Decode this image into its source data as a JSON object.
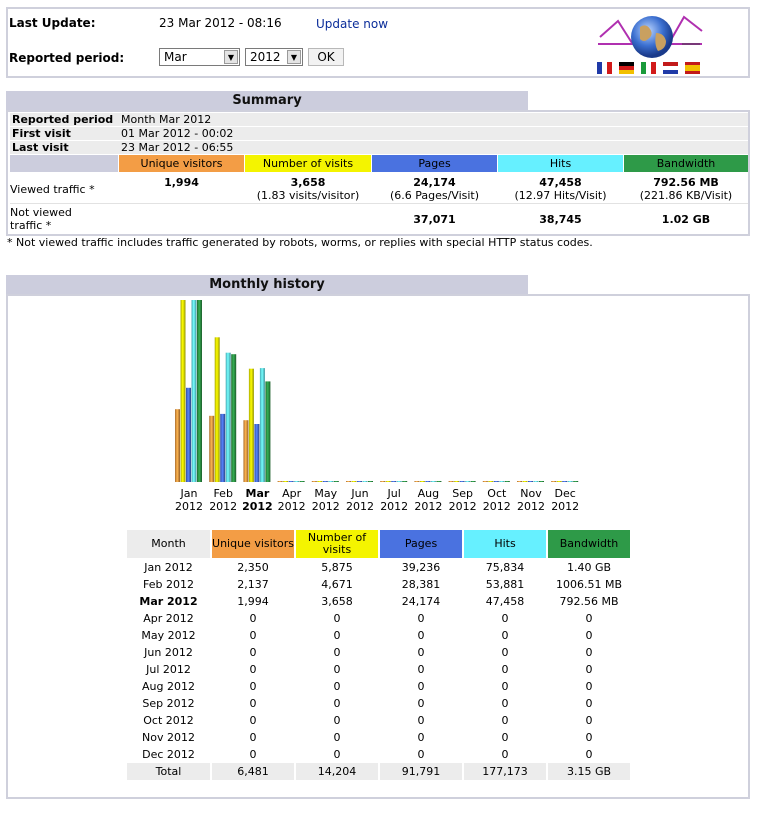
{
  "top": {
    "last_update_label": "Last Update:",
    "last_update_value": "23 Mar 2012 - 08:16",
    "update_now": "Update now",
    "reported_period_label": "Reported period:",
    "month_select": "Mar",
    "year_select": "2012",
    "ok": "OK"
  },
  "summary": {
    "title": "Summary",
    "reported_period_label": "Reported period",
    "reported_period_value": "Month Mar 2012",
    "first_visit_label": "First visit",
    "first_visit_value": "01 Mar 2012 - 00:02",
    "last_visit_label": "Last visit",
    "last_visit_value": "23 Mar 2012 - 06:55",
    "columns": [
      "Unique visitors",
      "Number of visits",
      "Pages",
      "Hits",
      "Bandwidth"
    ],
    "viewed_label": "Viewed traffic *",
    "viewed": {
      "unique": "1,994",
      "visits": "3,658",
      "visits_sub": "(1.83 visits/visitor)",
      "pages": "24,174",
      "pages_sub": "(6.6 Pages/Visit)",
      "hits": "47,458",
      "hits_sub": "(12.97 Hits/Visit)",
      "bandwidth": "792.56 MB",
      "bandwidth_sub": "(221.86 KB/Visit)"
    },
    "not_viewed_label_1": "Not viewed",
    "not_viewed_label_2": "traffic *",
    "not_viewed": {
      "pages": "37,071",
      "hits": "38,745",
      "bandwidth": "1.02 GB"
    },
    "footnote": "* Not viewed traffic includes traffic generated by robots, worms, or replies with special HTTP status codes."
  },
  "monthly": {
    "title": "Monthly history",
    "headers": [
      "Month",
      "Unique visitors",
      "Number of visits",
      "Pages",
      "Hits",
      "Bandwidth"
    ],
    "rows": [
      {
        "month": "Jan 2012",
        "unique": "2,350",
        "visits": "5,875",
        "pages": "39,236",
        "hits": "75,834",
        "bandwidth": "1.40 GB"
      },
      {
        "month": "Feb 2012",
        "unique": "2,137",
        "visits": "4,671",
        "pages": "28,381",
        "hits": "53,881",
        "bandwidth": "1006.51 MB"
      },
      {
        "month": "Mar 2012",
        "unique": "1,994",
        "visits": "3,658",
        "pages": "24,174",
        "hits": "47,458",
        "bandwidth": "792.56 MB"
      },
      {
        "month": "Apr 2012",
        "unique": "0",
        "visits": "0",
        "pages": "0",
        "hits": "0",
        "bandwidth": "0"
      },
      {
        "month": "May 2012",
        "unique": "0",
        "visits": "0",
        "pages": "0",
        "hits": "0",
        "bandwidth": "0"
      },
      {
        "month": "Jun 2012",
        "unique": "0",
        "visits": "0",
        "pages": "0",
        "hits": "0",
        "bandwidth": "0"
      },
      {
        "month": "Jul 2012",
        "unique": "0",
        "visits": "0",
        "pages": "0",
        "hits": "0",
        "bandwidth": "0"
      },
      {
        "month": "Aug 2012",
        "unique": "0",
        "visits": "0",
        "pages": "0",
        "hits": "0",
        "bandwidth": "0"
      },
      {
        "month": "Sep 2012",
        "unique": "0",
        "visits": "0",
        "pages": "0",
        "hits": "0",
        "bandwidth": "0"
      },
      {
        "month": "Oct 2012",
        "unique": "0",
        "visits": "0",
        "pages": "0",
        "hits": "0",
        "bandwidth": "0"
      },
      {
        "month": "Nov 2012",
        "unique": "0",
        "visits": "0",
        "pages": "0",
        "hits": "0",
        "bandwidth": "0"
      },
      {
        "month": "Dec 2012",
        "unique": "0",
        "visits": "0",
        "pages": "0",
        "hits": "0",
        "bandwidth": "0"
      }
    ],
    "total": {
      "month": "Total",
      "unique": "6,481",
      "visits": "14,204",
      "pages": "91,791",
      "hits": "177,173",
      "bandwidth": "3.15 GB"
    }
  },
  "colors": {
    "unique": "#f39d45",
    "visits": "#f4f400",
    "pages": "#4a72e0",
    "hits": "#66f0ff",
    "bandwidth": "#2e9a48",
    "header_tab": "#cccddd",
    "link": "#0b2d9a"
  },
  "chart_data": {
    "type": "bar",
    "categories": [
      {
        "month": "Jan",
        "year": "2012"
      },
      {
        "month": "Feb",
        "year": "2012"
      },
      {
        "month": "Mar",
        "year": "2012"
      },
      {
        "month": "Apr",
        "year": "2012"
      },
      {
        "month": "May",
        "year": "2012"
      },
      {
        "month": "Jun",
        "year": "2012"
      },
      {
        "month": "Jul",
        "year": "2012"
      },
      {
        "month": "Aug",
        "year": "2012"
      },
      {
        "month": "Sep",
        "year": "2012"
      },
      {
        "month": "Oct",
        "year": "2012"
      },
      {
        "month": "Nov",
        "year": "2012"
      },
      {
        "month": "Dec",
        "year": "2012"
      }
    ],
    "current_index": 2,
    "series": [
      {
        "key": "unique",
        "values": [
          2350,
          2137,
          1994,
          0,
          0,
          0,
          0,
          0,
          0,
          0,
          0,
          0
        ],
        "color": "#f39d45"
      },
      {
        "key": "visits",
        "values": [
          5875,
          4671,
          3658,
          0,
          0,
          0,
          0,
          0,
          0,
          0,
          0,
          0
        ],
        "color": "#f4f400"
      },
      {
        "key": "pages",
        "values": [
          39236,
          28381,
          24174,
          0,
          0,
          0,
          0,
          0,
          0,
          0,
          0,
          0
        ],
        "color": "#4a72e0"
      },
      {
        "key": "hits",
        "values": [
          75834,
          53881,
          47458,
          0,
          0,
          0,
          0,
          0,
          0,
          0,
          0,
          0
        ],
        "color": "#66f0ff"
      },
      {
        "key": "bandwidth_mb",
        "values": [
          1433.6,
          1006.51,
          792.56,
          0,
          0,
          0,
          0,
          0,
          0,
          0,
          0,
          0
        ],
        "color": "#2e9a48"
      }
    ],
    "scale_groups": [
      [
        "unique",
        "visits"
      ],
      [
        "pages",
        "hits"
      ],
      [
        "bandwidth_mb"
      ]
    ]
  }
}
